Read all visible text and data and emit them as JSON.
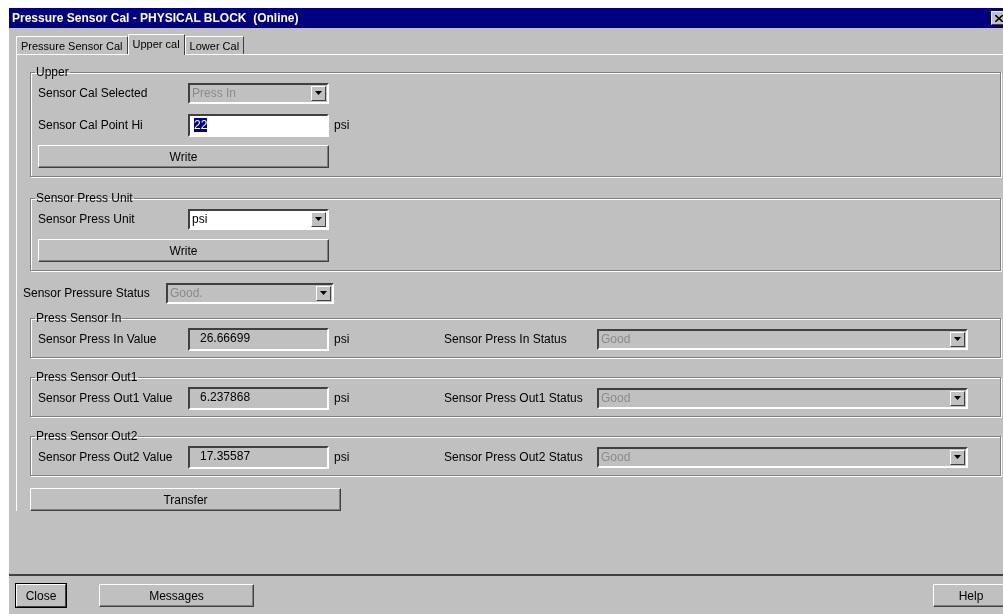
{
  "window": {
    "title": "Pressure Sensor Cal - PHYSICAL BLOCK  (Online)"
  },
  "tabs": [
    {
      "label": "Pressure Sensor Cal",
      "selected": false
    },
    {
      "label": "Upper cal",
      "selected": true
    },
    {
      "label": "Lower Cal",
      "selected": false
    }
  ],
  "upper_group": {
    "title": "Upper",
    "rows": [
      {
        "kind": "combo",
        "label": "Sensor Cal Selected",
        "value": "Press In",
        "disabled": true
      },
      {
        "kind": "input",
        "label": "Sensor Cal Point Hi",
        "value": "22",
        "unit": "psi",
        "highlighted": true
      }
    ],
    "button": "Write"
  },
  "unit_group": {
    "title": "Sensor Press Unit",
    "rows": [
      {
        "kind": "combo",
        "label": "Sensor Press Unit",
        "value": "psi",
        "disabled": false
      }
    ],
    "button": "Write"
  },
  "pressure_status": {
    "label": "Sensor Pressure Status",
    "value": "Good.",
    "disabled": true
  },
  "sensor_groups": [
    {
      "title": "Press Sensor In",
      "value_label": "Sensor Press In Value",
      "value": "26.66699",
      "unit": "psi",
      "status_label": "Sensor Press In Status",
      "status": "Good",
      "status_disabled": true
    },
    {
      "title": "Press Sensor Out1",
      "value_label": "Sensor Press Out1 Value",
      "value": "6.237868",
      "unit": "psi",
      "status_label": "Sensor Press Out1 Status",
      "status": "Good",
      "status_disabled": true
    },
    {
      "title": "Press Sensor Out2",
      "value_label": "Sensor Press Out2 Value",
      "value": "17.35587",
      "unit": "psi",
      "status_label": "Sensor Press Out2 Status",
      "status": "Good",
      "status_disabled": true
    }
  ],
  "transfer_button": "Transfer",
  "footer_buttons": [
    {
      "label": "Close",
      "default": true
    },
    {
      "label": "Messages",
      "default": false
    }
  ],
  "help_button": "Help"
}
